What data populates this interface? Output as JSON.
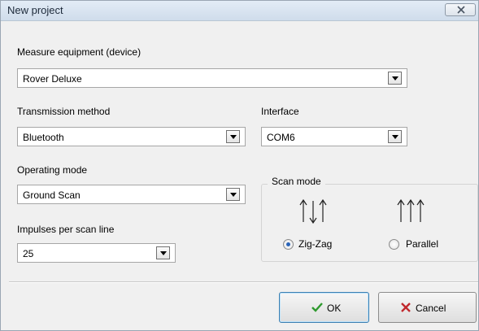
{
  "window": {
    "title": "New project",
    "close_icon": "close-x-icon"
  },
  "device": {
    "label": "Measure equipment (device)",
    "value": "Rover Deluxe"
  },
  "transmission": {
    "label": "Transmission method",
    "value": "Bluetooth"
  },
  "interface": {
    "label": "Interface",
    "value": "COM6"
  },
  "operating_mode": {
    "label": "Operating mode",
    "value": "Ground Scan"
  },
  "impulses": {
    "label": "Impulses per scan line",
    "value": "25"
  },
  "scan_mode": {
    "label": "Scan mode",
    "options": [
      {
        "label": "Zig-Zag",
        "selected": true,
        "icon": "zigzag-arrows-icon"
      },
      {
        "label": "Parallel",
        "selected": false,
        "icon": "parallel-arrows-icon"
      }
    ]
  },
  "buttons": {
    "ok": "OK",
    "cancel": "Cancel"
  },
  "colors": {
    "ok_check": "#2e9a2e",
    "cancel_x": "#c0282d",
    "radio_selected": "#2a64b8"
  }
}
